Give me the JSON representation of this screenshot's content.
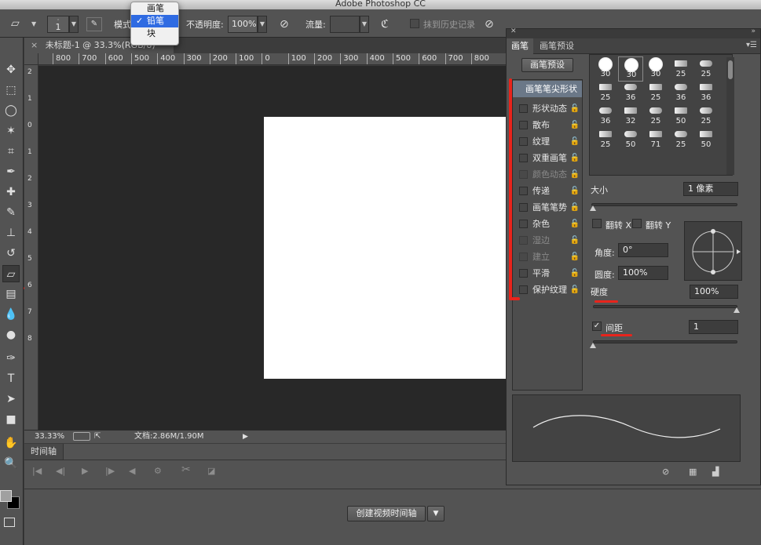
{
  "window": {
    "title": "Adobe Photoshop CC"
  },
  "options_bar": {
    "size_value": "1",
    "mode_label": "模式",
    "mode_menu": {
      "items": [
        "画笔",
        "铅笔",
        "块"
      ],
      "selected": "铅笔"
    },
    "opacity_label": "不透明度:",
    "opacity_value": "100%",
    "flow_label": "流量:",
    "flow_value": "",
    "erase_history_label": "抹到历史记录"
  },
  "document": {
    "tab_title": "未标题-1 @ 33.3%(RGB/8)",
    "ruler_labels": [
      "800",
      "700",
      "600",
      "500",
      "400",
      "300",
      "200",
      "100",
      "0",
      "100",
      "200",
      "300",
      "400",
      "500",
      "600",
      "700",
      "800"
    ],
    "vruler_labels": [
      "2",
      "1",
      "0",
      "1",
      "2",
      "3",
      "4",
      "5",
      "6",
      "7",
      "8"
    ],
    "zoom": "33.33%",
    "doc_size": "文档:2.86M/1.90M"
  },
  "timeline": {
    "tab_label": "时间轴",
    "create_button": "创建视频时间轴"
  },
  "brush_panel": {
    "tabs": [
      "画笔",
      "画笔预设"
    ],
    "preset_button": "画笔预设",
    "options": [
      {
        "label": "画笔笔尖形状",
        "kind": "tip"
      },
      {
        "label": "形状动态",
        "kind": "normal"
      },
      {
        "label": "散布",
        "kind": "normal"
      },
      {
        "label": "纹理",
        "kind": "normal"
      },
      {
        "label": "双重画笔",
        "kind": "normal"
      },
      {
        "label": "颜色动态",
        "kind": "dim"
      },
      {
        "label": "传递",
        "kind": "normal"
      },
      {
        "label": "画笔笔势",
        "kind": "normal"
      },
      {
        "label": "杂色",
        "kind": "normal"
      },
      {
        "label": "湿边",
        "kind": "dim"
      },
      {
        "label": "建立",
        "kind": "dim"
      },
      {
        "label": "平滑",
        "kind": "normal"
      },
      {
        "label": "保护纹理",
        "kind": "normal"
      }
    ],
    "tip_sizes": [
      [
        "30",
        "30",
        "30",
        "25",
        "25"
      ],
      [
        "25",
        "36",
        "25",
        "36",
        "36"
      ],
      [
        "36",
        "32",
        "25",
        "50",
        "25"
      ],
      [
        "25",
        "50",
        "71",
        "25",
        "50"
      ]
    ],
    "size_label": "大小",
    "size_value": "1 像素",
    "flip_x_label": "翻转 X",
    "flip_y_label": "翻转 Y",
    "angle_label": "角度:",
    "angle_value": "0°",
    "roundness_label": "圆度:",
    "roundness_value": "100%",
    "hardness_label": "硬度",
    "hardness_value": "100%",
    "spacing_label": "间距",
    "spacing_value": "1",
    "spacing_checked": true
  },
  "colors": {
    "accent_red": "#e8241c",
    "selection_blue": "#2f6be2"
  }
}
